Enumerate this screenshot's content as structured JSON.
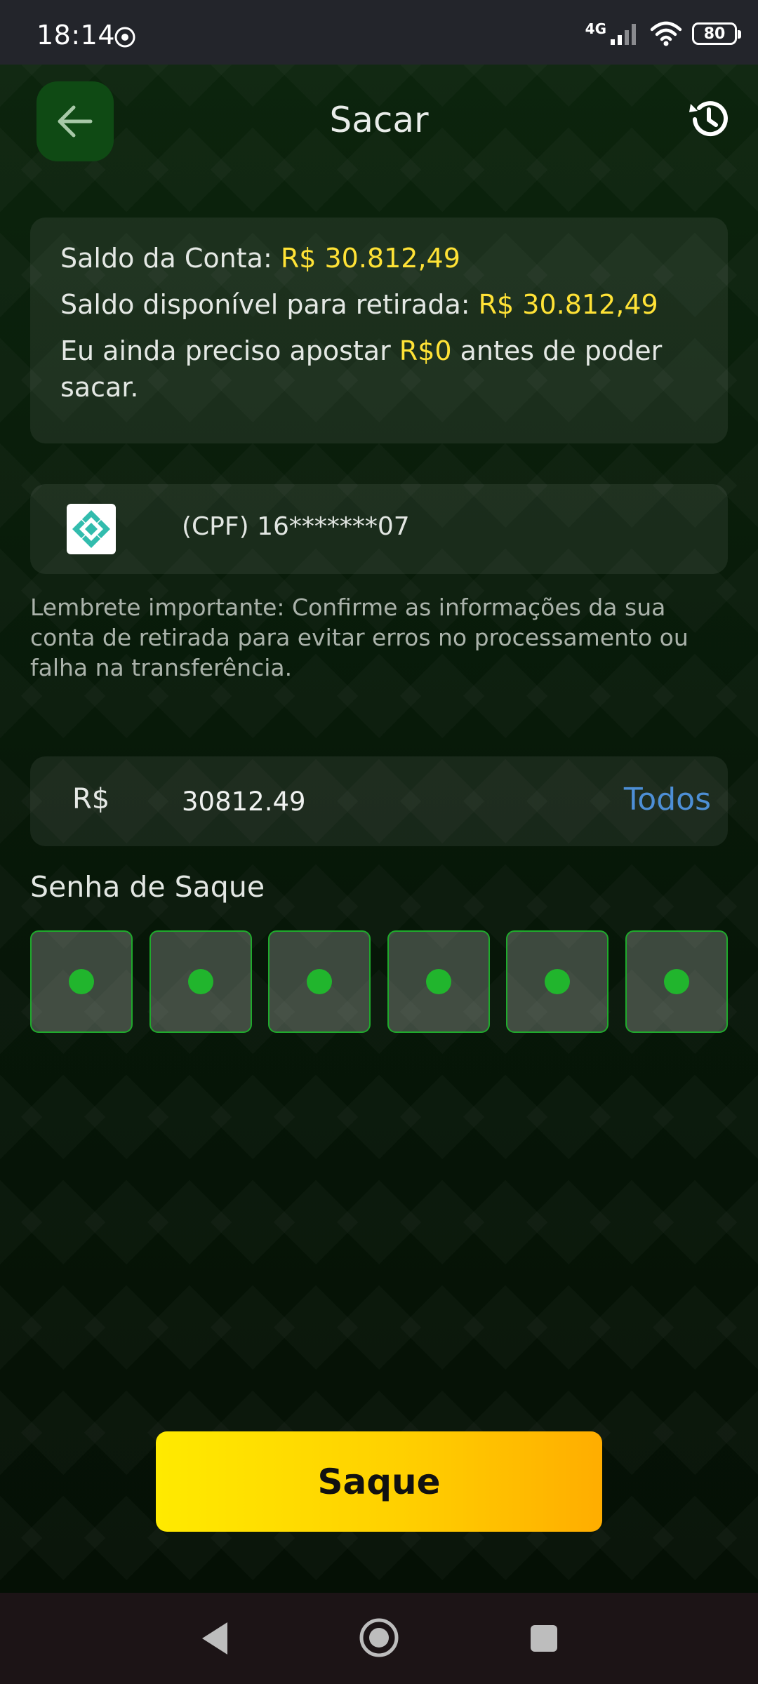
{
  "status": {
    "time": "18:14",
    "network": "4G",
    "battery": "80"
  },
  "header": {
    "title": "Sacar"
  },
  "balance": {
    "account_label": "Saldo da Conta: ",
    "account_value": "R$ 30.812,49",
    "available_label": "Saldo disponível para retirada: ",
    "available_value": "R$ 30.812,49",
    "bet_prefix": "Eu ainda preciso apostar ",
    "bet_value": "R$0",
    "bet_suffix": " antes de poder",
    "bet_suffix2": "sacar."
  },
  "account": {
    "cpf": "(CPF) 16*******07"
  },
  "reminder": "Lembrete importante: Confirme as informações da sua conta de retirada para evitar erros no processamento ou falha na transferência.",
  "amount": {
    "currency": "R$",
    "value": "30812.49",
    "all_label": "Todos"
  },
  "password": {
    "label": "Senha de Saque",
    "digits_filled": 6
  },
  "submit": {
    "label": "Saque"
  },
  "colors": {
    "highlight": "#ffe236",
    "link": "#4d8fd6",
    "pin_border": "#1faa2c",
    "button_start": "#ffea00",
    "button_end": "#ffad00"
  }
}
